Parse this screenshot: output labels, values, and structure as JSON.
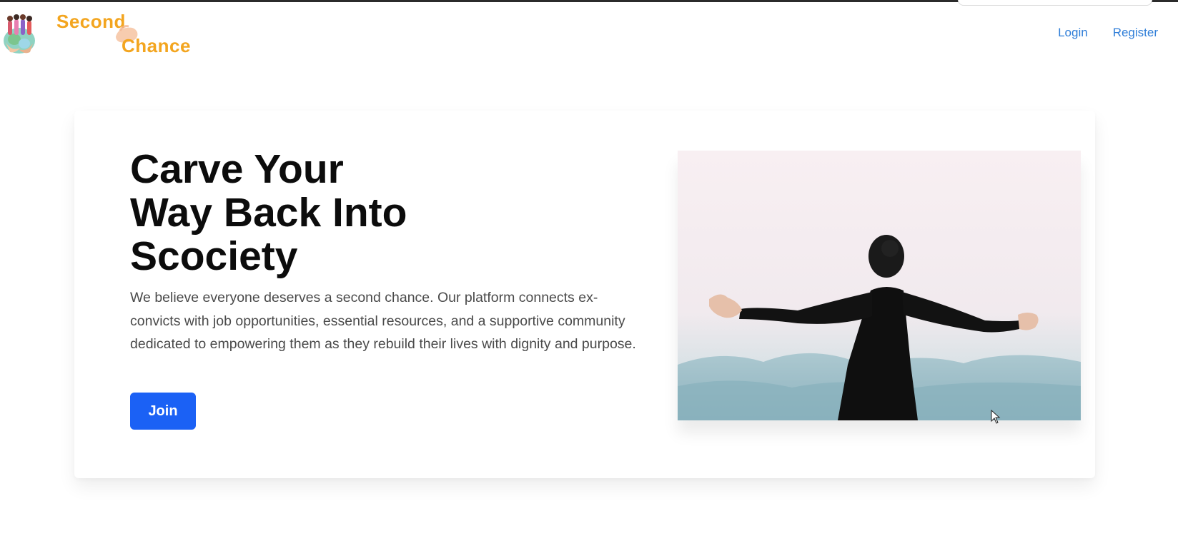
{
  "logo": {
    "line1": "Second",
    "line2": "Chance"
  },
  "nav": {
    "login": "Login",
    "register": "Register"
  },
  "hero": {
    "title_lines": [
      "Carve Your",
      "Way Back Into",
      "Scociety"
    ],
    "description": "We believe everyone deserves a second chance. Our platform connects ex-convicts with job opportunities, essential resources, and a supportive community dedicated to empowering them as they rebuild their lives with dignity and purpose.",
    "join_label": "Join"
  },
  "colors": {
    "brand": "#f3a51f",
    "link": "#2f7ed8",
    "primary_button": "#1b61f5"
  }
}
